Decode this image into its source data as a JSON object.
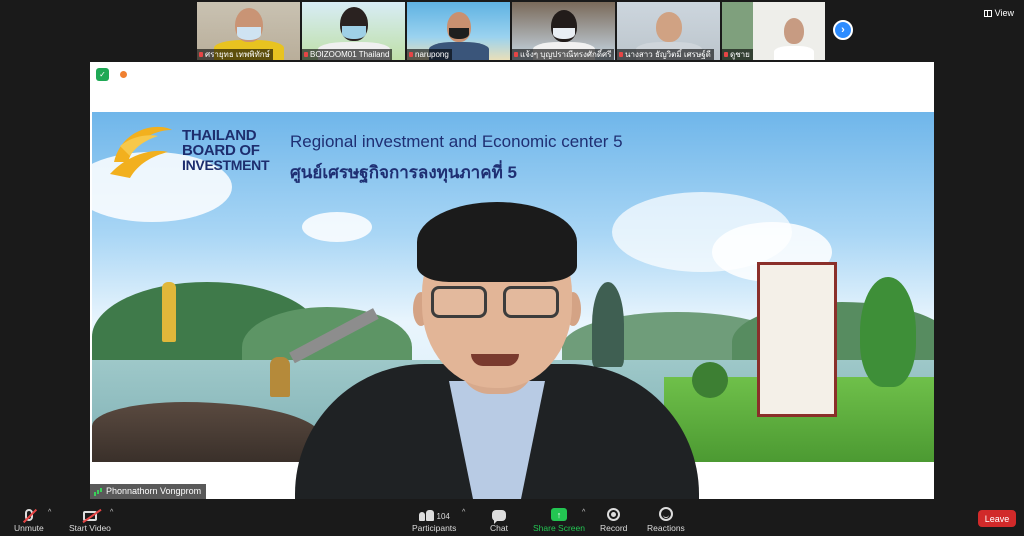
{
  "participants": [
    {
      "name": "ศรายุทธ เทพพิทักษ์"
    },
    {
      "name": "BOIZOOM01 Thailand"
    },
    {
      "name": "narupong"
    },
    {
      "name": "แจ้งๆ บุญปราณีทรงศักดิ์ศรี"
    },
    {
      "name": "นางสาว ธัญวิตมิ์ เศรษฐ์ดี"
    },
    {
      "name": "ดูชาย"
    }
  ],
  "top_controls": {
    "next_icon": "chevron-right-icon",
    "view_label": "View"
  },
  "banner": {
    "logo_line1": "THAILAND",
    "logo_line2": "BOARD OF",
    "logo_line3": "INVESTMENT",
    "title_en": "Regional investment and Economic center 5",
    "title_th": "ศูนย์เศรษฐกิจการลงทุนภาคที่ 5"
  },
  "speaker": {
    "name": "Phonnathorn Vongprom"
  },
  "toolbar": {
    "unmute": "Unmute",
    "start_video": "Start Video",
    "participants": "Participants",
    "participant_count": "104",
    "chat": "Chat",
    "share_screen": "Share Screen",
    "record": "Record",
    "reactions": "Reactions",
    "leave": "Leave"
  },
  "colors": {
    "accent": "#2d8cff",
    "share": "#23c552",
    "leave": "#d12a2a",
    "logo_gold": "#f2b01e",
    "logo_blue": "#1d2d6e"
  }
}
